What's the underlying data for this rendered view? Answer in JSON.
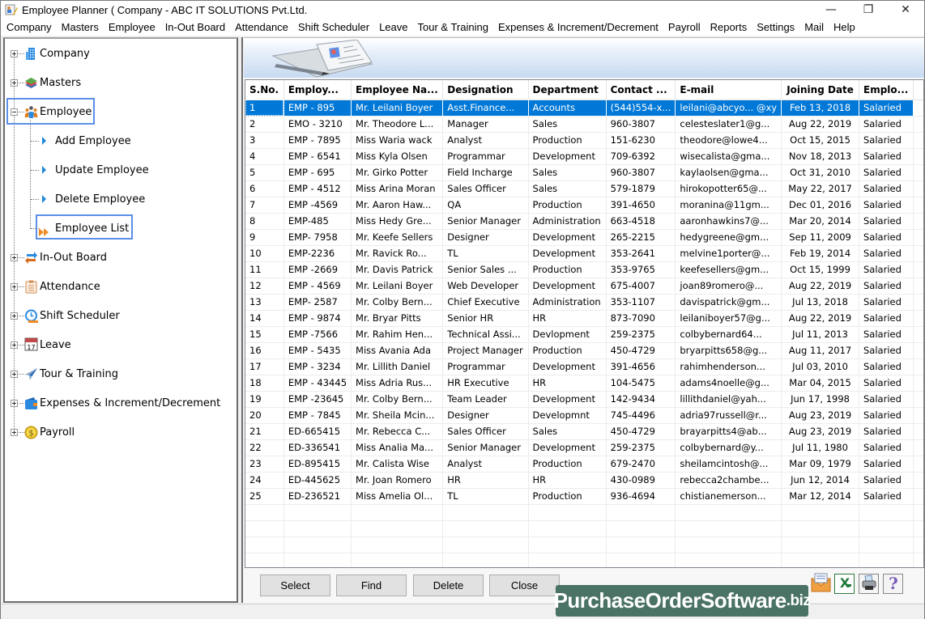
{
  "window": {
    "title": "Employee Planner ( Company - ABC IT SOLUTIONS Pvt.Ltd.",
    "controls": {
      "minimize": "—",
      "maximize": "❐",
      "close": "✕"
    }
  },
  "menubar": {
    "items": [
      "Company",
      "Masters",
      "Employee",
      "In-Out Board",
      "Attendance",
      "Shift Scheduler",
      "Leave",
      "Tour & Training",
      "Expenses & Increment/Decrement",
      "Payroll",
      "Reports",
      "Settings",
      "Mail",
      "Help"
    ]
  },
  "tree": {
    "nodes": [
      {
        "label": "Company",
        "icon": "building-icon",
        "expanded": false
      },
      {
        "label": "Masters",
        "icon": "layers-icon",
        "expanded": false
      },
      {
        "label": "Employee",
        "icon": "people-icon",
        "expanded": true,
        "selected": true
      },
      {
        "label": "In-Out Board",
        "icon": "swap-arrows-icon",
        "expanded": false
      },
      {
        "label": "Attendance",
        "icon": "clipboard-icon",
        "expanded": false
      },
      {
        "label": "Shift Scheduler",
        "icon": "clock-icon",
        "expanded": false
      },
      {
        "label": "Leave",
        "icon": "calendar-icon",
        "expanded": false
      },
      {
        "label": "Tour & Training",
        "icon": "airplane-icon",
        "expanded": false
      },
      {
        "label": "Expenses & Increment/Decrement",
        "icon": "wallet-icon",
        "expanded": false
      },
      {
        "label": "Payroll",
        "icon": "dollar-coin-icon",
        "expanded": false
      }
    ],
    "employee_children": [
      {
        "label": "Add Employee"
      },
      {
        "label": "Update Employee"
      },
      {
        "label": "Delete Employee"
      },
      {
        "label": "Employee List",
        "active": true
      }
    ],
    "calendar_icon_day": "17"
  },
  "grid": {
    "columns": [
      "S.No.",
      "Employ...",
      "Employee Na...",
      "Designation",
      "Department",
      "Contact ...",
      "E-mail",
      "Joining Date",
      "Emplo..."
    ],
    "selected_row": 0,
    "rows": [
      [
        "1",
        "EMP - 895",
        "Mr. Leilani Boyer",
        "Asst.Finance...",
        "Accounts",
        "(544)554-x...",
        "leilani@abcyo... @xy",
        "Feb 13, 2018",
        "Salaried"
      ],
      [
        "2",
        "EMO - 3210",
        "Mr. Theodore L...",
        "Manager",
        "Sales",
        "960-3807",
        "celesteslater1@g...",
        "Aug 22, 2019",
        "Salaried"
      ],
      [
        "3",
        "EMP - 7895",
        "Miss Waria wack",
        "Analyst",
        "Production",
        "151-6230",
        "theodore@lowe4...",
        "Oct 15, 2015",
        "Salaried"
      ],
      [
        "4",
        "EMP - 6541",
        "Miss Kyla Olsen",
        "Programmar",
        "Development",
        "709-6392",
        "wisecalista@gma...",
        "Nov 18, 2013",
        "Salaried"
      ],
      [
        "5",
        "EMP - 695",
        "Mr. Girko Potter",
        "Field Incharge",
        "Sales",
        "960-3807",
        "kaylaolsen@gma...",
        "Oct 31, 2010",
        "Salaried"
      ],
      [
        "6",
        "EMP - 4512",
        "Miss Arina Moran",
        "Sales Officer",
        "Sales",
        "579-1879",
        "hirokopotter65@...",
        "May 22, 2017",
        "Salaried"
      ],
      [
        "7",
        "EMP -4569",
        "Mr. Aaron Haw...",
        "QA",
        "Production",
        "391-4650",
        "moranina@11gm...",
        "Dec 01, 2016",
        "Salaried"
      ],
      [
        "8",
        "EMP-485",
        "Miss Hedy Gre...",
        "Senior Manager",
        "Administration",
        "663-4518",
        "aaronhawkins7@...",
        "Mar 20, 2014",
        "Salaried"
      ],
      [
        "9",
        "EMP- 7958",
        "Mr. Keefe Sellers",
        "Designer",
        "Development",
        "265-2215",
        "hedygreene@gm...",
        "Sep 11, 2009",
        "Salaried"
      ],
      [
        "10",
        "EMP-2236",
        "Mr. Ravick Ro...",
        "TL",
        "Development",
        "353-2641",
        "melvine1porter@...",
        "Feb 19, 2014",
        "Salaried"
      ],
      [
        "11",
        "EMP -2669",
        "Mr. Davis Patrick",
        "Senior Sales ...",
        "Production",
        "353-9765",
        "keefesellers@gm...",
        "Oct 15, 1999",
        "Salaried"
      ],
      [
        "12",
        "EMP - 4569",
        "Mr. Leilani Boyer",
        "Web Developer",
        "Development",
        "675-4007",
        "joan89romero@...",
        "Aug 22, 2019",
        "Salaried"
      ],
      [
        "13",
        "EMP- 2587",
        "Mr. Colby Bern...",
        "Chief Executive",
        "Administration",
        "353-1107",
        "davispatrick@gm...",
        "Jul 13, 2018",
        "Salaried"
      ],
      [
        "14",
        "EMP - 9874",
        "Mr. Bryar Pitts",
        "Senior HR",
        "HR",
        "873-7090",
        "leilaniboyer57@g...",
        "Aug 22, 2019",
        "Salaried"
      ],
      [
        "15",
        "EMP -7566",
        "Mr. Rahim Hen...",
        "Technical Assi...",
        "Devlopment",
        "259-2375",
        "colbybernard64...",
        "Jul 11, 2013",
        "Salaried"
      ],
      [
        "16",
        "EMP - 5435",
        "Miss Avania Ada",
        "Project Manager",
        "Production",
        "450-4729",
        "bryarpitts658@g...",
        "Aug 11, 2017",
        "Salaried"
      ],
      [
        "17",
        "EMP - 3234",
        "Mr. Lillith Daniel",
        "Programmar",
        "Development",
        "391-4656",
        "rahimhenderson...",
        "Jul 03, 2010",
        "Salaried"
      ],
      [
        "18",
        "EMP - 43445",
        "Miss Adria Rus...",
        "HR Executive",
        "HR",
        "104-5475",
        "adams4noelle@g...",
        "Mar 04, 2015",
        "Salaried"
      ],
      [
        "19",
        "EMP -23645",
        "Mr. Colby Bern...",
        "Team Leader",
        "Development",
        "142-9434",
        "lillithdaniel@yah...",
        "Jun 17, 1998",
        "Salaried"
      ],
      [
        "20",
        "EMP - 7845",
        "Mr. Sheila Mcin...",
        "Designer",
        "Developmnt",
        "745-4496",
        "adria97russell@r...",
        "Aug 23, 2019",
        "Salaried"
      ],
      [
        "21",
        "ED-665415",
        "Mr. Rebecca C...",
        "Sales Officer",
        "Sales",
        "450-4729",
        "brayarpitts4@ab...",
        "Aug 23, 2019",
        "Salaried"
      ],
      [
        "22",
        "ED-336541",
        "Miss Analia Ma...",
        "Senior Manager",
        "Development",
        "259-2375",
        "colbybernard@y...",
        "Jul 11, 1980",
        "Salaried"
      ],
      [
        "23",
        "ED-895415",
        "Mr. Calista Wise",
        "Analyst",
        "Production",
        "679-2470",
        "sheilamcintosh@...",
        "Mar 09, 1979",
        "Salaried"
      ],
      [
        "24",
        "ED-445625",
        "Mr. Joan Romero",
        "HR",
        "HR",
        "430-0989",
        "rebecca2chambe...",
        "Jun 12, 2014",
        "Salaried"
      ],
      [
        "25",
        "ED-236521",
        "Miss Amelia Ol...",
        "TL",
        "Production",
        "936-4694",
        "chistianemerson...",
        "Mar 12, 2014",
        "Salaried"
      ]
    ]
  },
  "buttons": {
    "select": "Select",
    "find": "Find",
    "delete": "Delete",
    "close": "Close"
  },
  "toolbar_icons": [
    "email-icon",
    "excel-icon",
    "printer-icon",
    "help-icon"
  ],
  "watermark": {
    "main": "PurchaseOrderSoftware",
    "tld": ".biz"
  },
  "colors": {
    "selection": "#0078d7",
    "tree_highlight": "#5b8fe8",
    "watermark_bg": "#4a7265"
  }
}
